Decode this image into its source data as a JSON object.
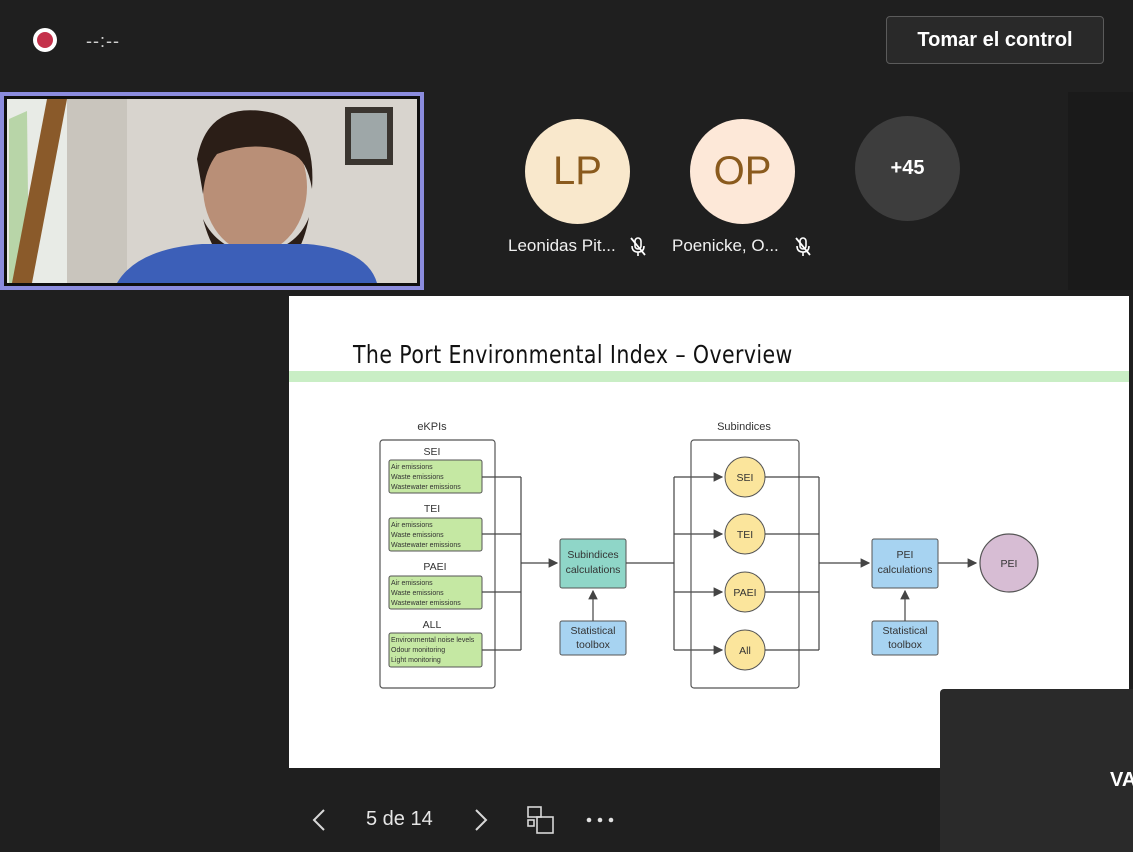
{
  "topbar": {
    "timer": "--:--",
    "take_control_label": "Tomar el control"
  },
  "participants": [
    {
      "initials": "LP",
      "name": "Leonidas Pit...",
      "muted": true
    },
    {
      "initials": "OP",
      "name": "Poenicke, O...",
      "muted": true
    },
    {
      "initials": "+45"
    }
  ],
  "slide": {
    "title": "The Port Environmental Index – Overview",
    "ekpis_label": "eKPIs",
    "subindices_label": "Subindices",
    "groups": [
      {
        "name": "SEI",
        "items": [
          "Air emissions",
          "Waste emissions",
          "Wastewater emissions"
        ]
      },
      {
        "name": "TEI",
        "items": [
          "Air emissions",
          "Waste emissions",
          "Wastewater emissions"
        ]
      },
      {
        "name": "PAEI",
        "items": [
          "Air emissions",
          "Waste emissions",
          "Wastewater emissions"
        ]
      },
      {
        "name": "ALL",
        "items": [
          "Environmental noise levels",
          "Odour monitoring",
          "Light monitoring"
        ]
      }
    ],
    "calc1": [
      "Subindices",
      "calculations"
    ],
    "toolbox1": [
      "Statistical",
      "toolbox"
    ],
    "subindices": [
      "SEI",
      "TEI",
      "PAEI",
      "All"
    ],
    "calc2": [
      "PEI",
      "calculations"
    ],
    "toolbox2": [
      "Statistical",
      "toolbox"
    ],
    "pei": "PEI"
  },
  "overlay": {
    "text": "VA"
  },
  "navigation": {
    "page_label": "5 de 14"
  },
  "colors": {
    "accent": "#8b8cde",
    "record": "#c4314b",
    "title_bar": "#c9eec5",
    "ekpi_box": "#c5e8a3",
    "calc_box": "#8fd6c8",
    "toolbox": "#a7d3f1",
    "subindex_circle": "#fbe59c",
    "pei_circle": "#d7bdd4"
  }
}
